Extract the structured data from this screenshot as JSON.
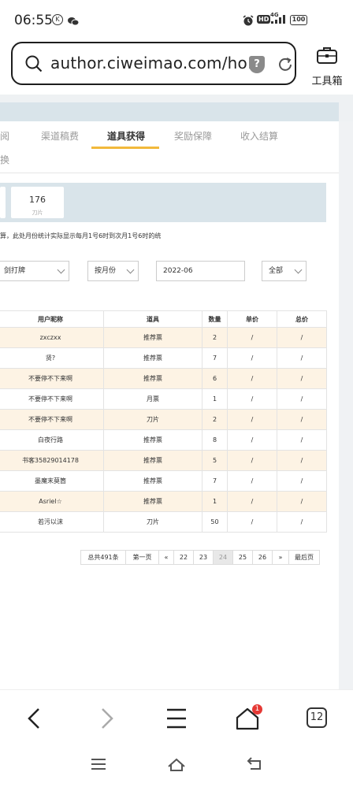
{
  "status_bar": {
    "time": "06:55",
    "left_icons": [
      "k-circle-icon",
      "wechat-icon"
    ],
    "right_icons": [
      "alarm-icon",
      "hd-icon",
      "4g-signal-icon",
      "battery-icon"
    ],
    "hd_label": "HD",
    "network_label": "4G",
    "battery": "100"
  },
  "browser": {
    "url": "author.ciweimao.com/ho…",
    "shield_glyph": "?",
    "toolbox_label": "工具箱",
    "tab_count": "12",
    "notification_badge": "1"
  },
  "tabs": [
    {
      "label": "阅"
    },
    {
      "label": "渠道稿费"
    },
    {
      "label": "道具获得",
      "active": true
    },
    {
      "label": "奖励保障"
    },
    {
      "label": "收入结算"
    },
    {
      "label": "换"
    }
  ],
  "stats": {
    "value": "176",
    "label": "刀片"
  },
  "notice": "算，此处月份统计实际显示每月1号6时到次月1号6时的统",
  "filters": {
    "book": "剑打牌",
    "period_type": "按月份",
    "month": "2022-06",
    "scope": "全部"
  },
  "table": {
    "headers": [
      "用户昵称",
      "道具",
      "数量",
      "单价",
      "总价"
    ],
    "rows": [
      [
        "zxczxx",
        "推荐票",
        "2",
        "/",
        "/"
      ],
      [
        "贤?",
        "推荐票",
        "7",
        "/",
        "/"
      ],
      [
        "不要停不下来啊",
        "推荐票",
        "6",
        "/",
        "/"
      ],
      [
        "不要停不下来啊",
        "月票",
        "1",
        "/",
        "/"
      ],
      [
        "不要停不下来啊",
        "刀片",
        "2",
        "/",
        "/"
      ],
      [
        "白夜行路",
        "推荐票",
        "8",
        "/",
        "/"
      ],
      [
        "书客35829014178",
        "推荐票",
        "5",
        "/",
        "/"
      ],
      [
        "墨魔末莫箇",
        "推荐票",
        "7",
        "/",
        "/"
      ],
      [
        "Asriel☆",
        "推荐票",
        "1",
        "/",
        "/"
      ],
      [
        "若污以沫",
        "刀片",
        "50",
        "/",
        "/"
      ]
    ]
  },
  "pagination": {
    "total": "总共491条",
    "first": "第一页",
    "prev": "«",
    "pages": [
      "22",
      "23",
      "24",
      "25",
      "26"
    ],
    "current": "24",
    "next": "»",
    "last": "最后页"
  },
  "colors": {
    "accent_underline": "#f2b93b",
    "row_highlight": "#fdf3e4",
    "stats_bg": "#d9e4ea",
    "badge": "#e53935"
  }
}
